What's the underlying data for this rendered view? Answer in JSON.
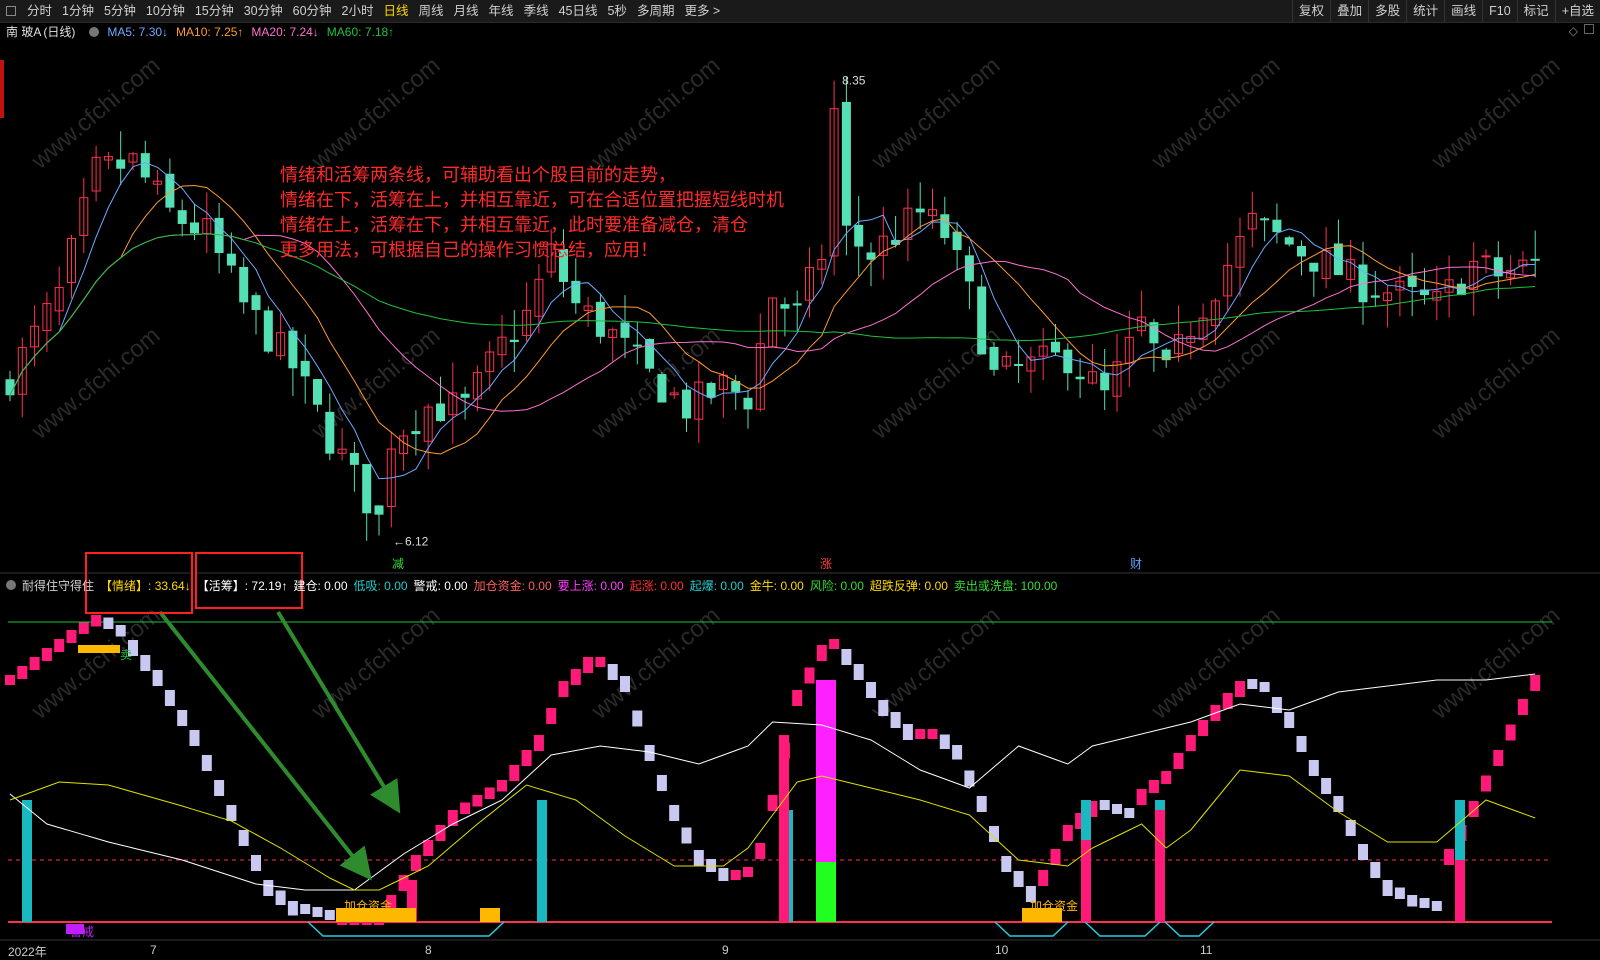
{
  "toolbar": {
    "periods": [
      "分时",
      "1分钟",
      "5分钟",
      "10分钟",
      "15分钟",
      "30分钟",
      "60分钟",
      "2小时",
      "日线",
      "周线",
      "月线",
      "年线",
      "季线",
      "45日线",
      "5秒",
      "多周期",
      "更多 >"
    ],
    "active_index": 8,
    "right_buttons": [
      "复权",
      "叠加",
      "多股",
      "统计",
      "画线",
      "F10",
      "标记",
      "+自选"
    ]
  },
  "main_header": {
    "stock_name": "南 玻A",
    "period_label": "(日线)",
    "ma5": "MA5: 7.30↓",
    "ma10": "MA10: 7.25↑",
    "ma20": "MA20: 7.24↓",
    "ma60": "MA60: 7.18↑"
  },
  "annotations": [
    "情绪和活筹两条线，可辅助看出个股目前的走势，",
    "情绪在下，活筹在上，并相互靠近，可在合适位置把握短线时机",
    "情绪在上，活筹在下，并相互靠近，此时要准备减仓，清仓",
    "更多用法，可根据自己的操作习惯总结，应用！"
  ],
  "price_labels": {
    "high": "8.35",
    "low": "6.12"
  },
  "event_markers": [
    {
      "text": "减",
      "color": "#33dd33"
    },
    {
      "text": "涨",
      "color": "#ff4040"
    },
    {
      "text": "财",
      "color": "#5ea0ff"
    }
  ],
  "indicator_header": {
    "name": "耐得住守得住",
    "items": [
      {
        "label": "【情绪】",
        "value": ": 33.64↓",
        "label_color": "#ffd800",
        "value_color": "#ffd800"
      },
      {
        "label": "【活筹】",
        "value": ": 72.19↑",
        "label_color": "#ffffff",
        "value_color": "#ffffff"
      },
      {
        "label": "建仓",
        "value": ": 0.00",
        "label_color": "#ffffff",
        "value_color": "#ffffff"
      },
      {
        "label": "低吸",
        "value": ": 0.00",
        "label_color": "#22cccc",
        "value_color": "#22cccc"
      },
      {
        "label": "警戒",
        "value": ": 0.00",
        "label_color": "#ffffff",
        "value_color": "#ffffff"
      },
      {
        "label": "加仓资金",
        "value": ": 0.00",
        "label_color": "#ff6060",
        "value_color": "#ff6060"
      },
      {
        "label": "要上涨",
        "value": ": 0.00",
        "label_color": "#ff40ff",
        "value_color": "#ff40ff"
      },
      {
        "label": "起涨",
        "value": ": 0.00",
        "label_color": "#ff3030",
        "value_color": "#ff3030"
      },
      {
        "label": "起爆",
        "value": ": 0.00",
        "label_color": "#22cccc",
        "value_color": "#22cccc"
      },
      {
        "label": "金牛",
        "value": ": 0.00",
        "label_color": "#ffd800",
        "value_color": "#ffd800"
      },
      {
        "label": "风险",
        "value": ": 0.00",
        "label_color": "#33dd33",
        "value_color": "#33dd33"
      },
      {
        "label": "超跌反弹",
        "value": ": 0.00",
        "label_color": "#ffd800",
        "value_color": "#ffd800"
      },
      {
        "label": "卖出或洗盘",
        "value": ": 100.00",
        "label_color": "#33dd33",
        "value_color": "#33dd33"
      }
    ]
  },
  "indicator_labels": {
    "sell": "卖",
    "warn": "警戒",
    "add": "加仓资金"
  },
  "x_axis": [
    "2022年",
    "7",
    "8",
    "9",
    "10",
    "11"
  ],
  "watermark": "www.cfchi.com",
  "colors": {
    "up": "#ff3050",
    "down": "#54e0b4",
    "ma5": "#6fa8ff",
    "ma10": "#ff9a30",
    "ma20": "#ff70d0",
    "ma60": "#20c040",
    "emotion": "#e0e000",
    "chips": "#ffffff",
    "box_pink": "#ff1a7a",
    "box_lav": "#c8c8f0",
    "cyan_bar": "#1ab8c0",
    "annotation": "#ff2a2a"
  }
}
